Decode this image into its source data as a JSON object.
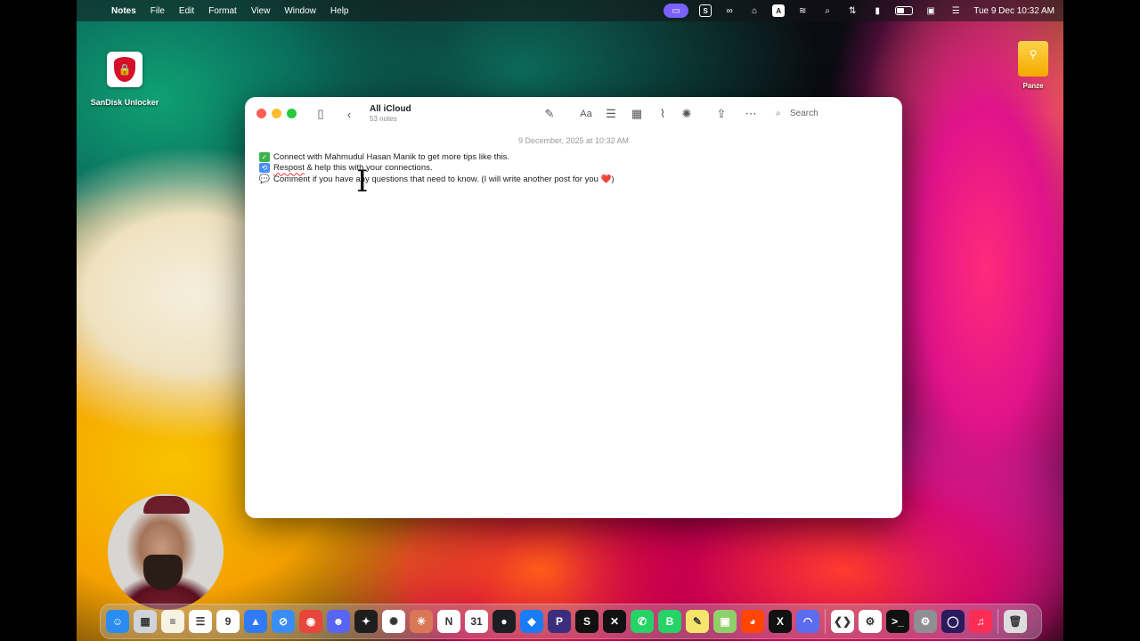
{
  "menubar": {
    "app_name": "Notes",
    "menus": [
      "File",
      "Edit",
      "Format",
      "View",
      "Window",
      "Help"
    ],
    "status_icons": [
      "screen-mirror-icon",
      "s-app-icon",
      "creative-cloud-icon",
      "clipboard-icon",
      "a-keyboard-icon",
      "wifi-icon",
      "spotlight-search-icon",
      "network-icon",
      "lock-icon",
      "battery-icon",
      "display-icon",
      "control-center-icon"
    ],
    "clock": "Tue 9 Dec  10:32 AM"
  },
  "desktop": {
    "icons": [
      {
        "label": "SanDisk Unlocker",
        "icon": "shield-lock-icon"
      },
      {
        "label": "Panze",
        "icon": "drive-icon"
      }
    ]
  },
  "notes_window": {
    "folder_title": "All iCloud",
    "folder_count": "53 notes",
    "search_placeholder": "Search",
    "note_date": "9 December, 2025 at 10:32 AM",
    "lines": [
      {
        "text": "Connect with Mahmudul Hasan Manik to get more tips like this."
      },
      {
        "misspelled": "Respost",
        "text": " & help this with your connections."
      },
      {
        "text": "Comment if you have any questions that need to know. (I will write another post for you ",
        "heart": "❤️",
        "after": ")"
      }
    ]
  },
  "dock": {
    "apps": [
      {
        "name": "finder",
        "color": "#2a8cf0",
        "glyph": "☺"
      },
      {
        "name": "launchpad",
        "color": "#cfd3da",
        "glyph": "▦"
      },
      {
        "name": "notes",
        "color": "#f7f3e3",
        "glyph": "≡"
      },
      {
        "name": "reminders",
        "color": "#ffffff",
        "glyph": "☰"
      },
      {
        "name": "calendar",
        "color": "#ffffff",
        "glyph": "9"
      },
      {
        "name": "testflight",
        "color": "#2f7bf5",
        "glyph": "▲"
      },
      {
        "name": "safari",
        "color": "#3a8df5",
        "glyph": "⊘"
      },
      {
        "name": "chrome",
        "color": "#e8453c",
        "glyph": "◉"
      },
      {
        "name": "discord",
        "color": "#5865f2",
        "glyph": "☻"
      },
      {
        "name": "figma",
        "color": "#1e1e1e",
        "glyph": "✦"
      },
      {
        "name": "chatgpt",
        "color": "#ffffff",
        "glyph": "✺"
      },
      {
        "name": "claude",
        "color": "#d97757",
        "glyph": "✳"
      },
      {
        "name": "notion",
        "color": "#ffffff",
        "glyph": "N"
      },
      {
        "name": "calendar-31",
        "color": "#ffffff",
        "glyph": "31"
      },
      {
        "name": "github",
        "color": "#1b1f23",
        "glyph": "●"
      },
      {
        "name": "framer",
        "color": "#1a7cf5",
        "glyph": "◆"
      },
      {
        "name": "proton",
        "color": "#3b2e7e",
        "glyph": "P"
      },
      {
        "name": "skype",
        "color": "#111111",
        "glyph": "S"
      },
      {
        "name": "capcut",
        "color": "#111111",
        "glyph": "✕"
      },
      {
        "name": "whatsapp",
        "color": "#25d366",
        "glyph": "✆"
      },
      {
        "name": "whatsapp-business",
        "color": "#25d366",
        "glyph": "B"
      },
      {
        "name": "pencil-app",
        "color": "#f5e66b",
        "glyph": "✎"
      },
      {
        "name": "preview",
        "color": "#8fd06a",
        "glyph": "▣"
      },
      {
        "name": "reddit",
        "color": "#ff4500",
        "glyph": "◕"
      },
      {
        "name": "x",
        "color": "#111111",
        "glyph": "X"
      },
      {
        "name": "arc",
        "color": "#5b6cf0",
        "glyph": "◠"
      },
      {
        "name": "vscode",
        "color": "#ffffff",
        "glyph": "❮❯"
      },
      {
        "name": "cursor-app",
        "color": "#ffffff",
        "glyph": "⚙"
      },
      {
        "name": "terminal",
        "color": "#111111",
        "glyph": ">_"
      },
      {
        "name": "settings",
        "color": "#8e8e93",
        "glyph": "⚙"
      },
      {
        "name": "orbit",
        "color": "#2a1a5e",
        "glyph": "◯"
      },
      {
        "name": "music",
        "color": "#fb2d55",
        "glyph": "♫"
      },
      {
        "name": "trash",
        "color": "#dddddd",
        "glyph": "🗑"
      }
    ]
  }
}
